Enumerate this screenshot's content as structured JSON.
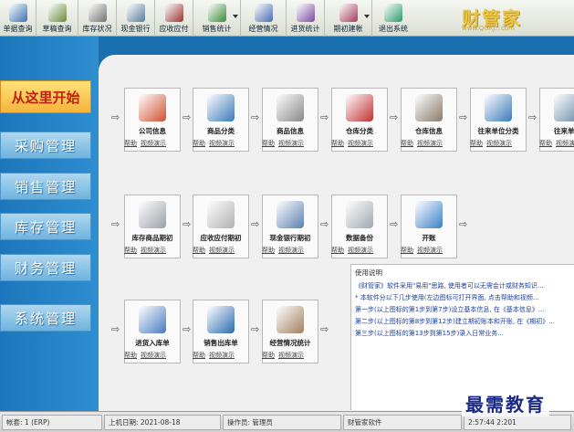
{
  "toolbar": {
    "items": [
      {
        "label": "单据查询",
        "color": "#3a6fb0"
      },
      {
        "label": "草稿查询",
        "color": "#6a8a3a"
      },
      {
        "label": "库存状况",
        "color": "#707070"
      },
      {
        "label": "现金银行",
        "color": "#5a7a9a"
      },
      {
        "label": "应收应付",
        "color": "#9a3030"
      },
      {
        "label": "销售统计",
        "color": "#3a8a3a"
      },
      {
        "label": "经营情况",
        "color": "#4a6ab0"
      },
      {
        "label": "进货统计",
        "color": "#7a4aa0"
      },
      {
        "label": "期初建帐",
        "color": "#a03a5a"
      },
      {
        "label": "退出系统",
        "color": "#2a9a6a"
      }
    ]
  },
  "brand": {
    "title": "财管家",
    "url": "www.QGKJ...com"
  },
  "sidebar": {
    "start": "从这里开始",
    "items": [
      "采购管理",
      "销售管理",
      "库存管理",
      "财务管理",
      "系统管理"
    ]
  },
  "common": {
    "help": "帮助",
    "video": "视频演示"
  },
  "cards": [
    {
      "title": "公司信息",
      "color": "#d05030"
    },
    {
      "title": "商品分类",
      "color": "#3a7ab8"
    },
    {
      "title": "商品信息",
      "color": "#888888"
    },
    {
      "title": "仓库分类",
      "color": "#c03030"
    },
    {
      "title": "仓库信息",
      "color": "#8a7a6a"
    },
    {
      "title": "往来单位分类",
      "color": "#3a7ab8"
    },
    {
      "title": "往来单位",
      "color": "#6a8aa8"
    },
    {
      "title": "库存商品期初",
      "color": "#9aa0a8"
    },
    {
      "title": "应收应付期初",
      "color": "#b0b0b0"
    },
    {
      "title": "现金银行期初",
      "color": "#5a80b0"
    },
    {
      "title": "数据备份",
      "color": "#a0a8b0"
    },
    {
      "title": "开账",
      "color": "#3a80c8"
    },
    {
      "title": "进货入库单",
      "color": "#4a7ac0"
    },
    {
      "title": "销售出库单",
      "color": "#2a6ab0"
    },
    {
      "title": "经营情况统计",
      "color": "#a08060"
    }
  ],
  "instructions": {
    "title": "使用说明",
    "paragraphs": [
      "《财管家》软件采用\"易用\"思路, 使用者可以无需会计或财务知识...",
      "* 本软件分以下几步使用(左边图标可打开界面, 点击帮助和视频...",
      "第一步(以上图标的第1步到第7步)设立基本信息, 在《基本信息》...",
      "第二步(以上图标的第8步到第12步)建立期初账本和开账, 在《期初》...",
      "第三步(以上图标的第13步到第15步)录入日常业务..."
    ]
  },
  "status": {
    "account": "帐套:  1  (ERP)",
    "login_date": "上机日期:  2021-08-18",
    "operator": "操作员:  管理员",
    "software": "财管家软件",
    "time": "2:57:44 2:201"
  },
  "watermark": "最需教育"
}
